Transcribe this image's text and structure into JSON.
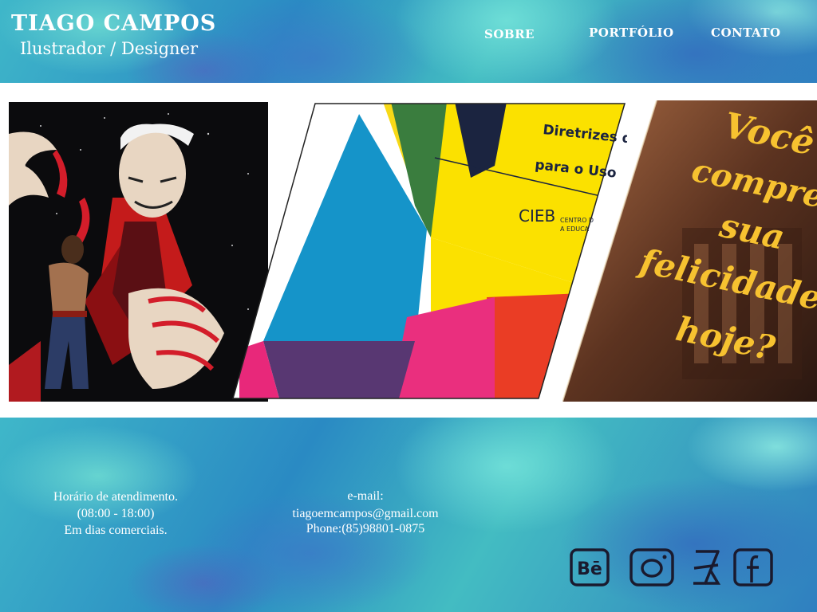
{
  "header": {
    "name": "TIAGO CAMPOS",
    "role": "Ilustrador / Designer",
    "nav": {
      "sobre": "SOBRE",
      "portfolio": "PORTFÓLIO",
      "contato": "CONTATO"
    }
  },
  "gallery": {
    "items": [
      {
        "kind": "illustration"
      },
      {
        "kind": "book-cover",
        "text_line1": "Diretrizes d",
        "text_line2": "para o Uso",
        "logo_text": "CIEB",
        "logo_sub1": "CENTRO D",
        "logo_sub2": "A EDUCA"
      },
      {
        "kind": "lettering",
        "text_lines": [
          "Você",
          "compre",
          "sua",
          "felicidade",
          "hoje?"
        ]
      }
    ]
  },
  "footer": {
    "hours_title": "Horário de atendimento.",
    "hours_time": "(08:00 - 18:00)",
    "hours_days": "Em dias comerciais.",
    "email_label": "e-mail:",
    "email": "tiagoemcampos@gmail.com",
    "phone": "Phone:(85)98801-0875",
    "social": [
      {
        "icon": "behance-icon",
        "label": "Bē"
      },
      {
        "icon": "instagram-icon"
      },
      {
        "icon": "artstation-icon"
      },
      {
        "icon": "facebook-icon"
      }
    ]
  },
  "colors": {
    "accent_yellow": "#f7c230",
    "icon_stroke": "#1a1a2e",
    "text": "#ffffff"
  }
}
